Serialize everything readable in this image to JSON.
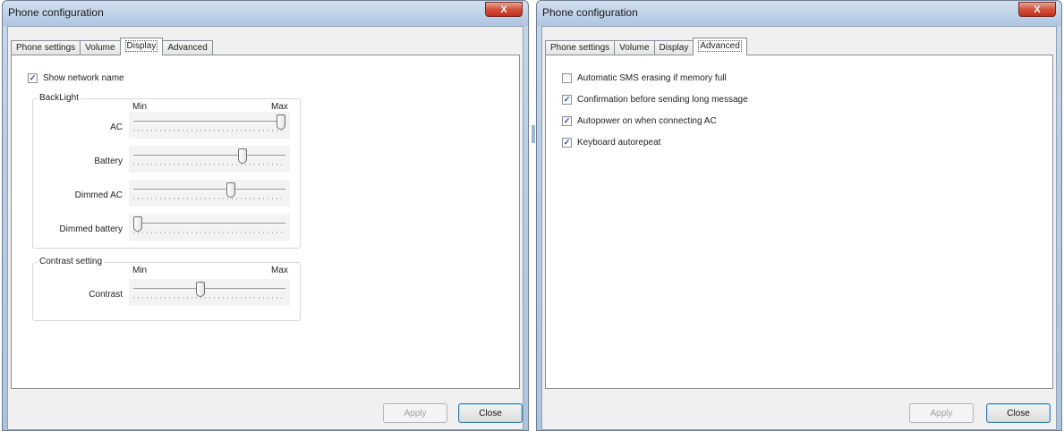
{
  "close_glyph": "X",
  "left_window": {
    "title": "Phone configuration",
    "tabs": [
      "Phone settings",
      "Volume",
      "Display",
      "Advanced"
    ],
    "active_tab": 2,
    "show_network_name": {
      "label": "Show network name",
      "checked": true
    },
    "backlight": {
      "label": "BackLight",
      "min_label": "Min",
      "max_label": "Max",
      "sliders": [
        {
          "label": "AC",
          "value": 1.0
        },
        {
          "label": "Battery",
          "value": 0.73
        },
        {
          "label": "Dimmed AC",
          "value": 0.65
        },
        {
          "label": "Dimmed battery",
          "value": 0.0
        }
      ]
    },
    "contrast": {
      "label": "Contrast setting",
      "min_label": "Min",
      "max_label": "Max",
      "slider": {
        "label": "Contrast",
        "value": 0.44
      }
    },
    "apply_label": "Apply",
    "close_label": "Close"
  },
  "right_window": {
    "title": "Phone configuration",
    "tabs": [
      "Phone settings",
      "Volume",
      "Display",
      "Advanced"
    ],
    "active_tab": 3,
    "options": [
      {
        "label": "Automatic SMS erasing if memory full",
        "checked": false
      },
      {
        "label": "Confirmation before sending long message",
        "checked": true
      },
      {
        "label": "Autopower on when connecting AC",
        "checked": true
      },
      {
        "label": "Keyboard autorepeat",
        "checked": true
      }
    ],
    "apply_label": "Apply",
    "close_label": "Close"
  }
}
